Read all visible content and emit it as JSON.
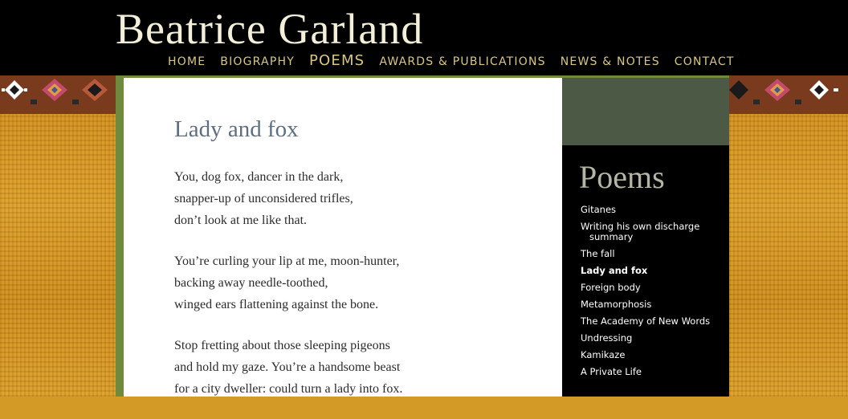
{
  "site": {
    "title": "Beatrice Garland"
  },
  "nav": {
    "items": [
      {
        "label": "HOME"
      },
      {
        "label": "BIOGRAPHY"
      },
      {
        "label": "POEMS",
        "active": true
      },
      {
        "label": "AWARDS & PUBLICATIONS"
      },
      {
        "label": "NEWS & NOTES"
      },
      {
        "label": "CONTACT"
      }
    ]
  },
  "poem": {
    "title": "Lady and fox",
    "stanzas": [
      [
        "You, dog fox, dancer in the dark,",
        "snapper-up of unconsidered trifles,",
        "don’t look at me like that."
      ],
      [
        "You’re curling your lip at me, moon-hunter,",
        "backing away needle-toothed,",
        "winged ears flattening against the bone."
      ],
      [
        "Stop fretting about those sleeping pigeons",
        "and hold my gaze.  You’re a handsome beast",
        "for a city dweller: could turn a lady into fox."
      ]
    ]
  },
  "sidebar": {
    "heading": "Poems",
    "items": [
      {
        "label": "Gitanes"
      },
      {
        "label": "Writing his own discharge",
        "label2": "summary"
      },
      {
        "label": "The fall"
      },
      {
        "label": "Lady and fox",
        "current": true
      },
      {
        "label": "Foreign body"
      },
      {
        "label": "Metamorphosis"
      },
      {
        "label": "The Academy of New Words"
      },
      {
        "label": "Undressing"
      },
      {
        "label": "Kamikaze"
      },
      {
        "label": "A Private Life"
      }
    ]
  },
  "colors": {
    "header_bg": "#000000",
    "nav_text": "#d9c77e",
    "title_text": "#f4efd9",
    "poem_title": "#5d6f80",
    "sidebar_bg": "#000000",
    "sidebar_top": "#4c5a45",
    "accent_green": "#6f8a3c",
    "textile_gold": "#d39a26"
  }
}
